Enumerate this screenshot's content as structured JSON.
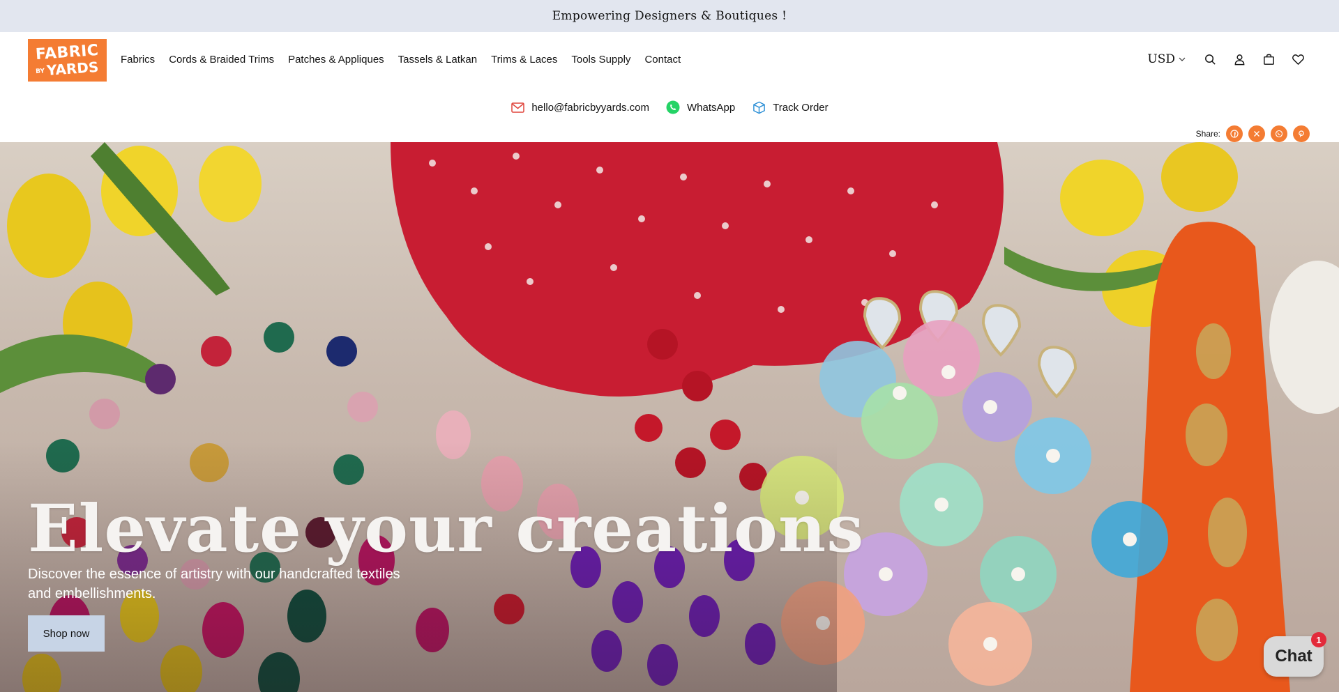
{
  "announcement": {
    "text": "Empowering Designers & Boutiques !"
  },
  "logo": {
    "line1": "FABRIC",
    "line2_small": "BY",
    "line2": "YARDS"
  },
  "nav": {
    "items": [
      {
        "label": "Fabrics"
      },
      {
        "label": "Cords & Braided Trims"
      },
      {
        "label": "Patches & Appliques"
      },
      {
        "label": "Tassels & Latkan"
      },
      {
        "label": "Trims & Laces"
      },
      {
        "label": "Tools Supply"
      },
      {
        "label": "Contact"
      }
    ]
  },
  "header_icons": {
    "currency": "USD",
    "icons": [
      "search-icon",
      "account-icon",
      "cart-icon",
      "wishlist-icon"
    ]
  },
  "contact": {
    "email": "hello@fabricbyyards.com",
    "whatsapp": "WhatsApp",
    "track": "Track Order"
  },
  "share": {
    "label": "Share:",
    "icons": [
      "facebook-icon",
      "x-icon",
      "whatsapp-icon",
      "pinterest-icon"
    ]
  },
  "hero": {
    "title": "Elevate your creations",
    "subtitle": "Discover the essence of artistry with our handcrafted textiles and embellishments.",
    "button": "Shop now"
  },
  "chat": {
    "label": "Chat",
    "badge": "1"
  },
  "colors": {
    "brand_orange": "#f47c33",
    "announcement_bg": "#e2e6ef",
    "button_bg": "#c7d4e6",
    "chat_badge": "#e32a3a"
  }
}
